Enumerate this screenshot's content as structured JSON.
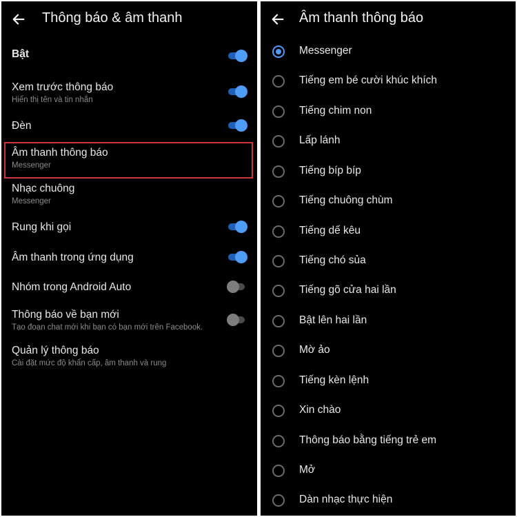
{
  "left": {
    "title": "Thông báo & âm thanh",
    "settings": [
      {
        "title": "Bật",
        "subtitle": "",
        "toggle": "on"
      },
      {
        "title": "Xem trước thông báo",
        "subtitle": "Hiển thị tên và tin nhắn",
        "toggle": "on"
      },
      {
        "title": "Đèn",
        "subtitle": "",
        "toggle": "on"
      },
      {
        "title": "Âm thanh thông báo",
        "subtitle": "Messenger",
        "toggle": "none",
        "highlighted": true
      },
      {
        "title": "Nhạc chuông",
        "subtitle": "Messenger",
        "toggle": "none"
      },
      {
        "title": "Rung khi gọi",
        "subtitle": "",
        "toggle": "on"
      },
      {
        "title": "Âm thanh trong ứng dụng",
        "subtitle": "",
        "toggle": "on"
      },
      {
        "title": "Nhóm trong Android Auto",
        "subtitle": "",
        "toggle": "off"
      },
      {
        "title": "Thông báo về bạn mới",
        "subtitle": "Tạo đoạn chat mới khi bạn có bạn mới trên Facebook.",
        "toggle": "off"
      },
      {
        "title": "Quản lý thông báo",
        "subtitle": "Cài đặt mức độ khẩn cấp, âm thanh và rung",
        "toggle": "none"
      }
    ]
  },
  "right": {
    "title": "Âm thanh thông báo",
    "selected_index": 0,
    "options": [
      "Messenger",
      "Tiếng em bé cười khúc khích",
      "Tiếng chim non",
      "Lấp lánh",
      "Tiếng bíp bíp",
      "Tiếng chuông chùm",
      "Tiếng dế kêu",
      "Tiếng chó sủa",
      "Tiếng gõ cửa hai lần",
      "Bật lên hai lần",
      "Mờ ảo",
      "Tiếng kèn lệnh",
      "Xin chào",
      "Thông báo bằng tiếng trẻ em",
      "Mở",
      "Dàn nhạc thực hiện"
    ]
  },
  "colors": {
    "accent": "#4f9cf7",
    "highlight": "#d2343a",
    "background": "#000000"
  },
  "icons": {
    "back": "arrow-left-icon",
    "toggle": "switch-icon",
    "radio": "radio-button-icon"
  }
}
